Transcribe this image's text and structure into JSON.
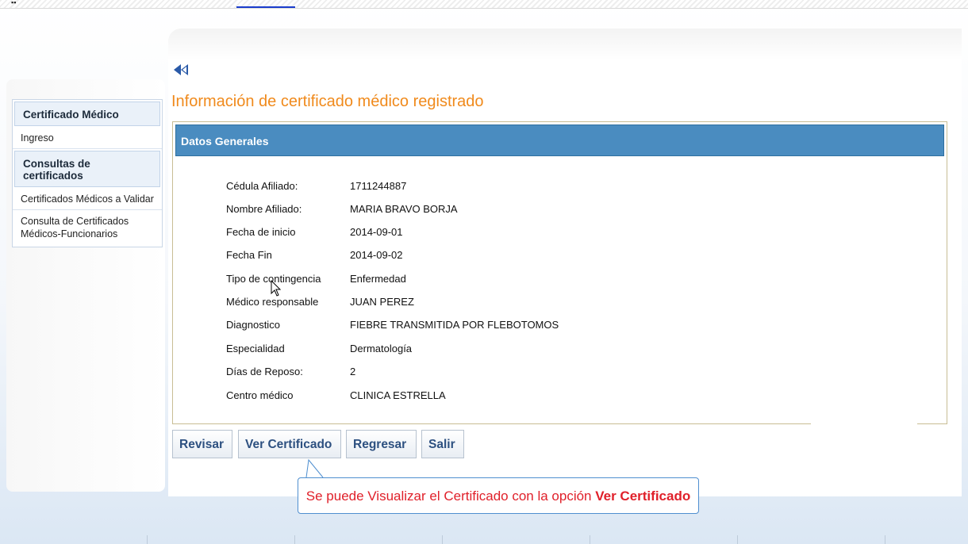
{
  "sidebar": {
    "section1_title": "Certificado Médico",
    "item_ingreso": "Ingreso",
    "section2_title": "Consultas de certificados",
    "item_validar": "Certificados Médicos a Validar",
    "item_consulta_line1": "Consulta de Certificados",
    "item_consulta_line2": "Médicos-Funcionarios"
  },
  "page": {
    "title": "Información de certificado médico registrado",
    "section_header": "Datos Generales"
  },
  "fields": [
    {
      "label": "Cédula Afiliado:",
      "value": "1711244887"
    },
    {
      "label": "Nombre Afiliado:",
      "value": "MARIA BRAVO BORJA"
    },
    {
      "label": "Fecha de inicio",
      "value": "2014-09-01"
    },
    {
      "label": "Fecha Fin",
      "value": "2014-09-02"
    },
    {
      "label": "Tipo de contingencia",
      "value": "Enfermedad"
    },
    {
      "label": "Médico responsable",
      "value": "JUAN PEREZ"
    },
    {
      "label": "Diagnostico",
      "value": "FIEBRE TRANSMITIDA POR FLEBOTOMOS"
    },
    {
      "label": "Especialidad",
      "value": "Dermatología"
    },
    {
      "label": "Días de Reposo:",
      "value": "2"
    },
    {
      "label": "Centro médico",
      "value": "CLINICA ESTRELLA"
    }
  ],
  "buttons": {
    "revisar": "Revisar",
    "ver_certificado": "Ver Certificado",
    "regresar": "Regresar",
    "salir": "Salir"
  },
  "callout": {
    "text": "Se puede Visualizar el Certificado con la opción ",
    "emphasis": "Ver Certificado"
  },
  "colors": {
    "title": "#f08a1c",
    "header_bar": "#4a8cc0",
    "button_text": "#2d5080",
    "callout_text": "#e0202a"
  },
  "icons": [
    "back-double-arrow-icon",
    "mouse-pointer-icon"
  ]
}
